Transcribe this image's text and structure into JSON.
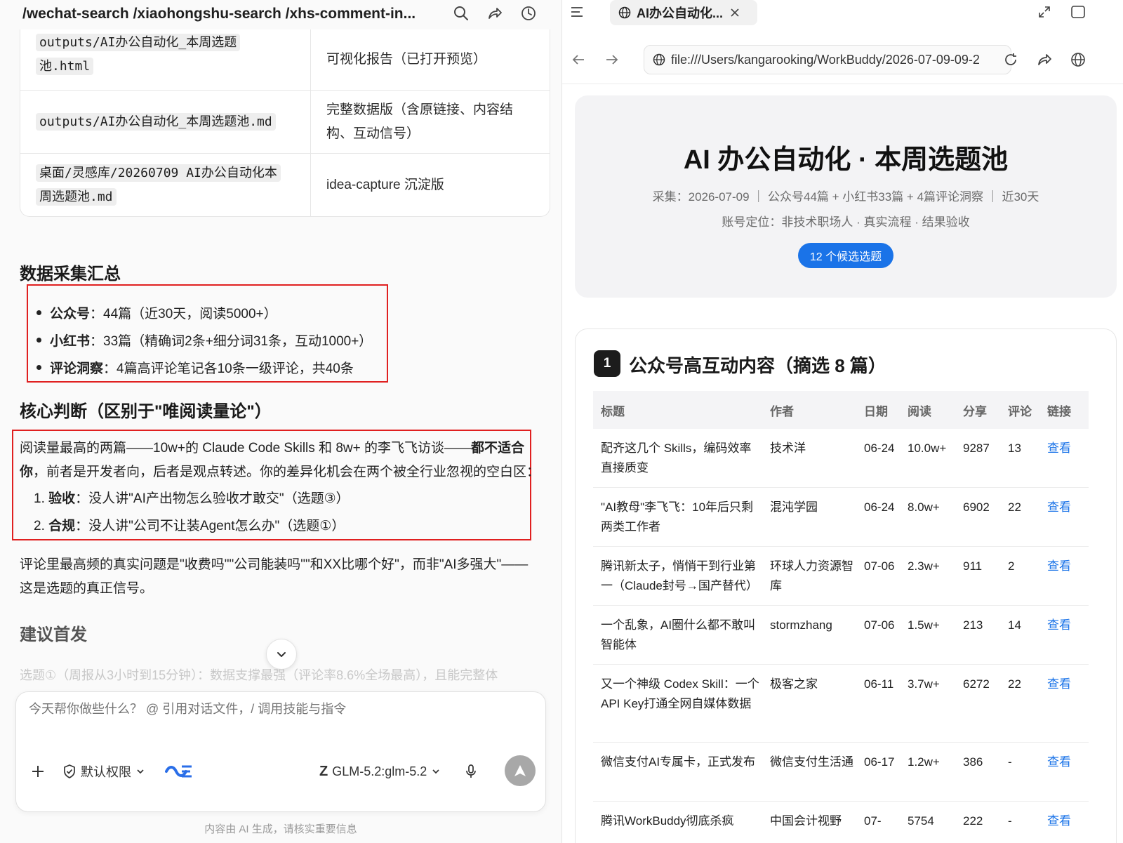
{
  "left": {
    "title": "/wechat-search /xiaohongshu-search /xhs-comment-in...",
    "files": [
      {
        "path_lines": [
          "outputs/AI办公自动化_本周选题",
          "池.html"
        ],
        "desc_lines": [
          "可视化报告（已打开预览）"
        ]
      },
      {
        "path_lines": [
          "outputs/AI办公自动化_本周选题池.md"
        ],
        "desc_lines": [
          "完整数据版（含原链接、内容结",
          "构、互动信号）"
        ]
      },
      {
        "path_lines": [
          "桌面/灵感库/20260709 AI办公自动化本",
          "周选题池.md"
        ],
        "desc_lines": [
          "idea-capture 沉淀版"
        ]
      }
    ],
    "summary_heading": "数据采集汇总",
    "summary_items": [
      {
        "label": "公众号",
        "text": "：44篇（近30天，阅读5000+）"
      },
      {
        "label": "小红书",
        "text": "：33篇（精确词2条+细分词31条，互动1000+）"
      },
      {
        "label": "评论洞察",
        "text": "：4篇高评论笔记各10条一级评论，共40条"
      }
    ],
    "core_heading": "核心判断（区别于\"唯阅读量论\"）",
    "core_para_1a": "阅读量最高的两篇——10w+的 Claude Code Skills 和 8w+ 的李飞飞访谈——",
    "core_para_1b": "都不适合",
    "core_para_2a": "你",
    "core_para_2b": "，前者是开发者向，后者是观点转述。你的差异化机会在两个被全行业忽视的空白区：",
    "core_items": [
      {
        "num": "1.",
        "label": "验收",
        "text": "：没人讲\"AI产出物怎么验收才敢交\"（选题③）"
      },
      {
        "num": "2.",
        "label": "合规",
        "text": "：没人讲\"公司不让装Agent怎么办\"（选题①）"
      }
    ],
    "insight_line_1": "评论里最高频的真实问题是\"收费吗\"\"公司能装吗\"\"和XX比哪个好\"，而非\"AI多强大\"——",
    "insight_line_2": "这是选题的真正信号。",
    "suggest_heading": "建议首发",
    "faded_text": "选题①（周报从3小时到15分钟）：数据支撑最强（评论率8.6%全场最高），且能完整体",
    "composer_placeholder": "今天帮你做些什么？ @ 引用对话文件，/ 调用技能与指令",
    "permission_label": "默认权限",
    "model_label": "GLM-5.2:glm-5.2",
    "disclaimer": "内容由 AI 生成，请核实重要信息"
  },
  "right": {
    "tab_title": "AI办公自动化...",
    "url": "file:///Users/kangarooking/WorkBuddy/2026-07-09-09-2",
    "hero_title": "AI 办公自动化 · 本周选题池",
    "hero_meta": "采集：2026-07-09 ｜ 公众号44篇 + 小红书33篇 + 4篇评论洞察 ｜ 近30天",
    "hero_positioning": "账号定位：非技术职场人 · 真实流程 · 结果验收",
    "hero_badge": "12 个候选选题",
    "section_number": "1",
    "section_title": "公众号高互动内容（摘选 8 篇）",
    "table_headers": [
      "标题",
      "作者",
      "日期",
      "阅读",
      "分享",
      "评论",
      "链接"
    ],
    "rows": [
      {
        "title": "配齐这几个 Skills，编码效率直接质变",
        "author": "技术洋",
        "date": "06-24",
        "read": "10.0w+",
        "share": "9287",
        "comments": "13",
        "link": "查看"
      },
      {
        "title": "\"AI教母\"李飞飞：10年后只剩两类工作者",
        "author": "混沌学园",
        "date": "06-24",
        "read": "8.0w+",
        "share": "6902",
        "comments": "22",
        "link": "查看"
      },
      {
        "title": "腾讯新太子，悄悄干到行业第一（Claude封号→国产替代）",
        "author": "环球人力资源智库",
        "date": "07-06",
        "read": "2.3w+",
        "share": "911",
        "comments": "2",
        "link": "查看"
      },
      {
        "title": "一个乱象，AI圈什么都不敢叫智能体",
        "author": "stormzhang",
        "date": "07-06",
        "read": "1.5w+",
        "share": "213",
        "comments": "14",
        "link": "查看"
      },
      {
        "title": "又一个神级 Codex Skill：一个API Key打通全网自媒体数据",
        "author": "极客之家",
        "date": "06-11",
        "read": "3.7w+",
        "share": "6272",
        "comments": "22",
        "link": "查看"
      },
      {
        "title": "微信支付AI专属卡，正式发布",
        "author": "微信支付生活通",
        "date": "06-17",
        "read": "1.2w+",
        "share": "386",
        "comments": "-",
        "link": "查看"
      },
      {
        "title": "腾讯WorkBuddy彻底杀疯",
        "author": "中国会计视野",
        "date": "07-",
        "read": "5754",
        "share": "222",
        "comments": "-",
        "link": "查看"
      }
    ]
  },
  "colors": {
    "accent": "#1a73e8",
    "highlight_border": "#e02020"
  }
}
